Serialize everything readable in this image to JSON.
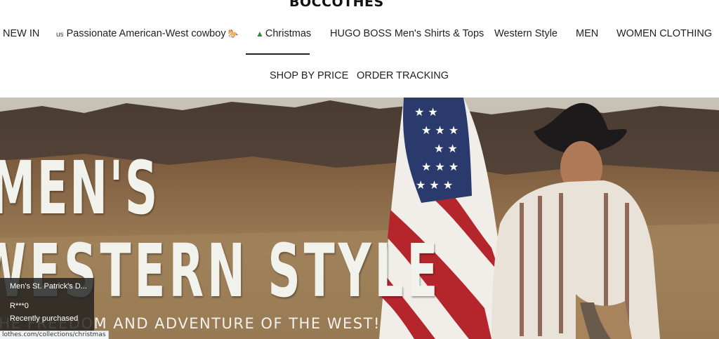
{
  "brand": {
    "logo_text": "BOCCOTHES"
  },
  "nav": {
    "row1": [
      {
        "label": "NEW IN"
      },
      {
        "label": "Passionate American-West cowboy",
        "prefix": "us",
        "suffix_icon": "horse-icon"
      },
      {
        "label": "Christmas",
        "prefix_icon": "christmas-tree-icon",
        "active": true
      },
      {
        "label": "HUGO BOSS Men's Shirts & Tops"
      },
      {
        "label": "Western Style"
      },
      {
        "label": "MEN"
      },
      {
        "label": "WOMEN CLOTHING"
      }
    ],
    "row2": [
      {
        "label": "SHOP BY PRICE"
      },
      {
        "label": "ORDER TRACKING"
      }
    ]
  },
  "hero": {
    "line1": "MEN'S",
    "line2": "WESTERN STYLE",
    "subtitle": "THE FREEDOM AND ADVENTURE OF THE WEST!"
  },
  "popup": {
    "product": "Men's St. Patrick's D...",
    "user": "R***0",
    "status": "Recently purchased"
  },
  "status_bar": {
    "url": "lothes.com/collections/christmas"
  }
}
